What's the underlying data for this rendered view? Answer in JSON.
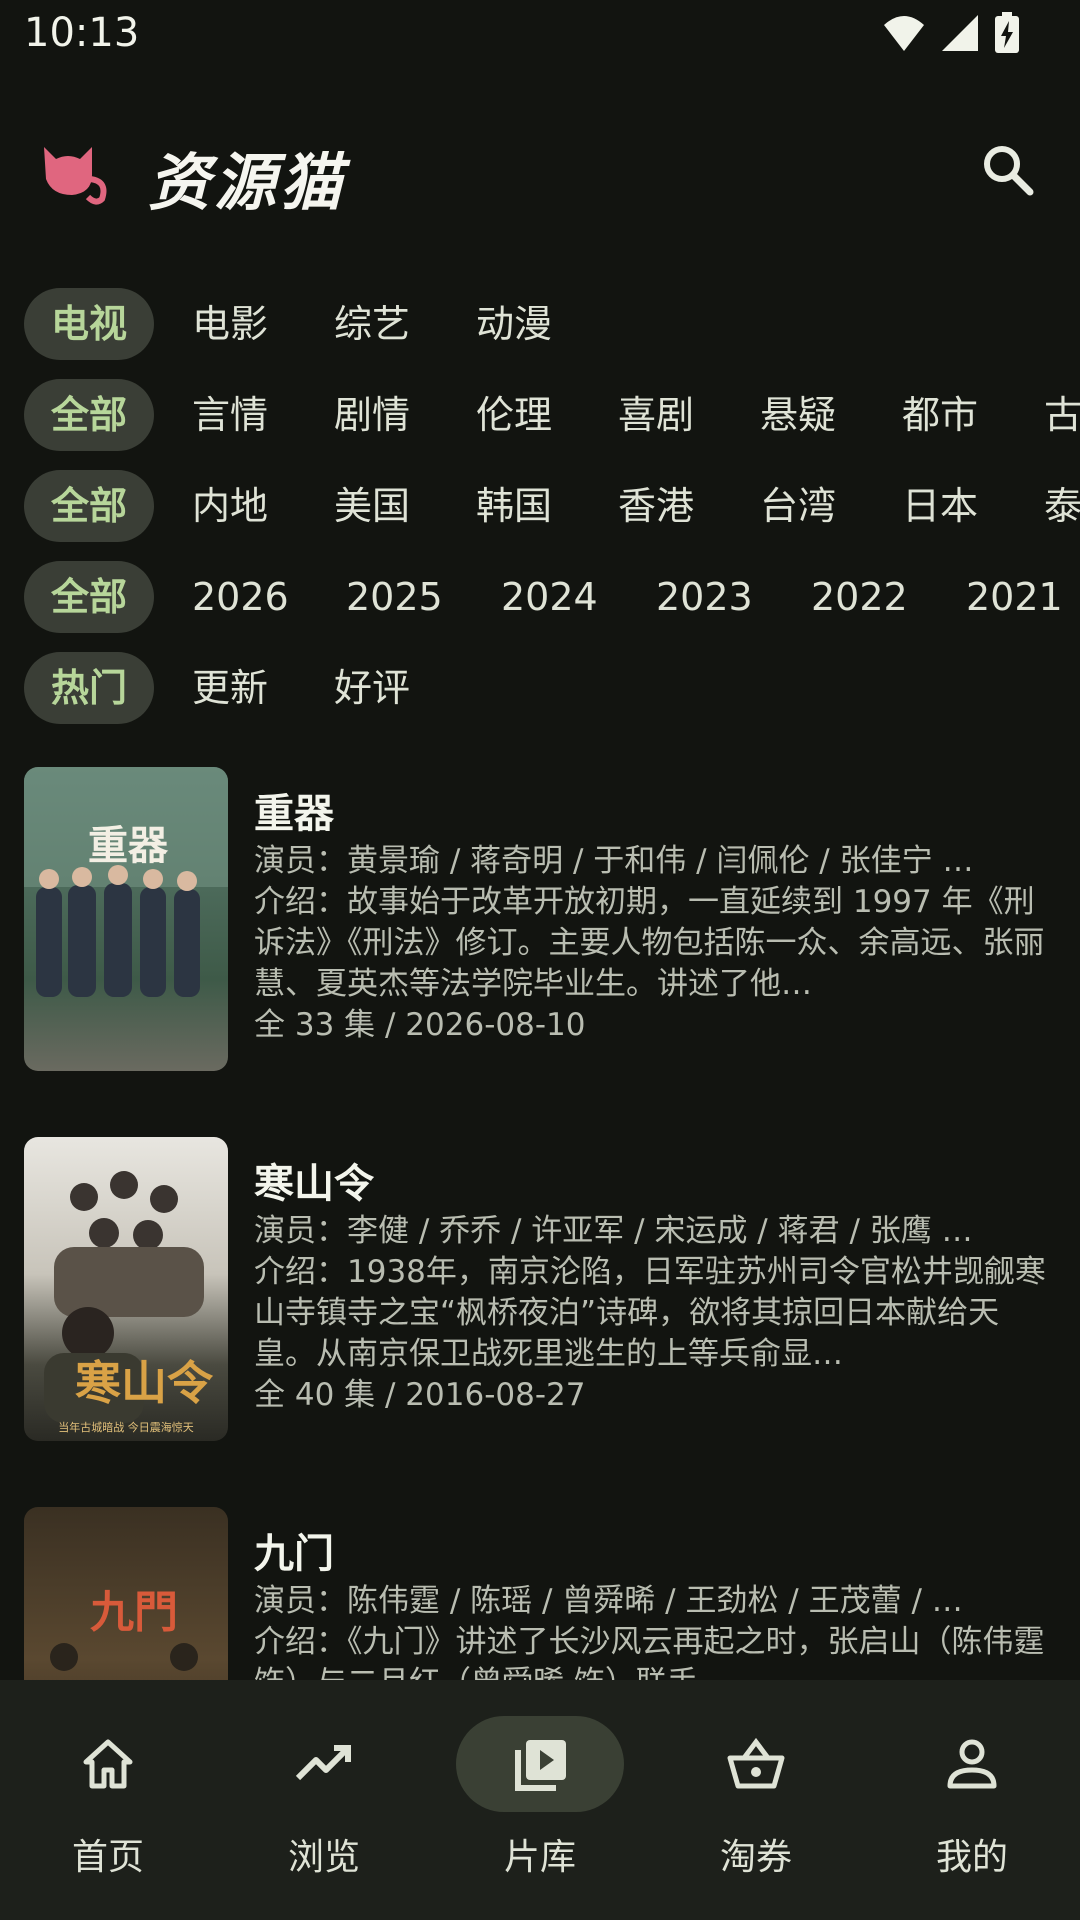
{
  "status_bar": {
    "time": "10:13"
  },
  "app": {
    "title": "资源猫"
  },
  "filters": {
    "types": {
      "selected": "电视",
      "items": [
        "电影",
        "综艺",
        "动漫"
      ]
    },
    "genres": {
      "selected": "全部",
      "items": [
        "言情",
        "剧情",
        "伦理",
        "喜剧",
        "悬疑",
        "都市",
        "古"
      ]
    },
    "regions": {
      "selected": "全部",
      "items": [
        "内地",
        "美国",
        "韩国",
        "香港",
        "台湾",
        "日本",
        "泰"
      ]
    },
    "years": {
      "selected": "全部",
      "items": [
        "2026",
        "2025",
        "2024",
        "2023",
        "2022",
        "2021"
      ]
    },
    "sort": {
      "selected": "热门",
      "items": [
        "更新",
        "好评"
      ]
    }
  },
  "list": [
    {
      "title": "重器",
      "actors": "演员：黄景瑜 / 蒋奇明 / 于和伟 / 闫佩伦 / 张佳宁 …",
      "intro": "介绍：故事始于改革开放初期，一直延续到 1997 年《刑诉法》《刑法》修订。主要人物包括陈一众、余高远、张丽慧、夏英杰等法学院毕业生。讲述了他…",
      "meta": "全 33 集 / 2026-08-10",
      "poster_text": "重器"
    },
    {
      "title": "寒山令",
      "actors": "演员：李健 / 乔乔 / 许亚军 / 宋运成 / 蒋君 / 张鹰 …",
      "intro": "介绍：1938年，南京沦陷，日军驻苏州司令官松井觊觎寒山寺镇寺之宝“枫桥夜泊”诗碑，欲将其掠回日本献给天皇。从南京保卫战死里逃生的上等兵俞显…",
      "meta": "全 40 集 / 2016-08-27",
      "poster_text": "寒山令",
      "poster_caption": "当年古城暗战   今日震海惊天"
    },
    {
      "title": "九门",
      "actors": "演员：陈伟霆 / 陈瑶 / 曾舜晞 / 王劲松 / 王茂蕾 / …",
      "intro": "介绍：《九门》讲述了长沙风云再起之时，张启山（陈伟霆 饰）与二月红（曾舜晞 饰）联手…",
      "meta": "",
      "poster_text": "九門"
    }
  ],
  "bottom_nav": [
    {
      "label": "首页",
      "icon": "home-icon"
    },
    {
      "label": "浏览",
      "icon": "trending-icon"
    },
    {
      "label": "片库",
      "icon": "video-library-icon",
      "active": true
    },
    {
      "label": "淘券",
      "icon": "basket-icon"
    },
    {
      "label": "我的",
      "icon": "person-icon"
    }
  ],
  "colors": {
    "background": "#121410",
    "accent": "#b7d69a",
    "chip_bg": "#3a3e36",
    "logo": "#e0667f"
  }
}
